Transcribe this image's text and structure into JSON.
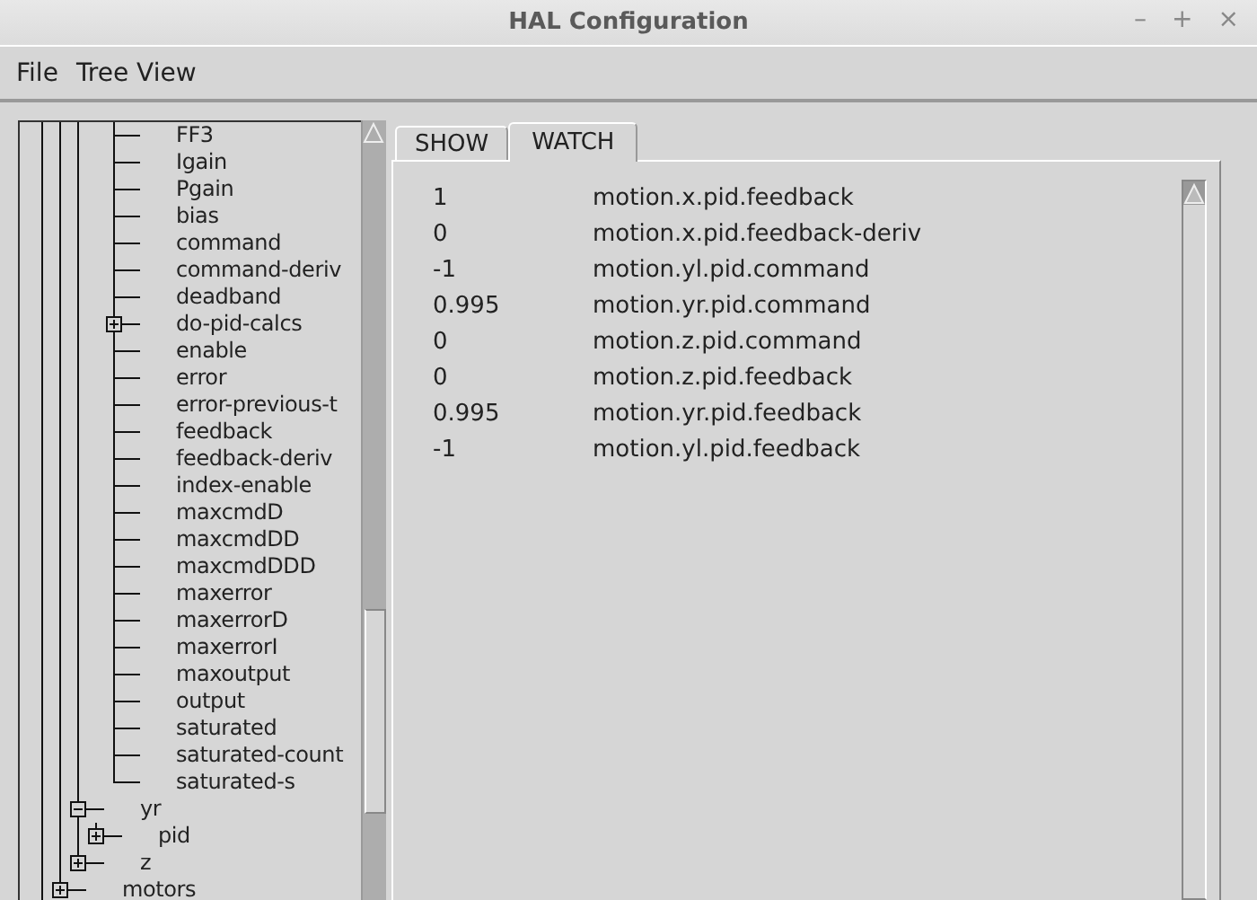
{
  "window": {
    "title": "HAL Configuration",
    "controls": [
      "–",
      "+",
      "×"
    ]
  },
  "menu": [
    "File",
    "Tree View"
  ],
  "tree": {
    "items": [
      {
        "children": [
          {
            "children": [
              {
                "children": [
                  {
                    "children": [
                      {
                        "label": "FF3"
                      },
                      {
                        "label": "Igain"
                      },
                      {
                        "label": "Pgain"
                      },
                      {
                        "label": "bias"
                      },
                      {
                        "label": "command"
                      },
                      {
                        "label": "command-deriv"
                      },
                      {
                        "label": "deadband"
                      },
                      {
                        "label": "do-pid-calcs",
                        "expanded": false
                      },
                      {
                        "label": "enable"
                      },
                      {
                        "label": "error"
                      },
                      {
                        "label": "error-previous-t"
                      },
                      {
                        "label": "feedback"
                      },
                      {
                        "label": "feedback-deriv"
                      },
                      {
                        "label": "index-enable"
                      },
                      {
                        "label": "maxcmdD"
                      },
                      {
                        "label": "maxcmdDD"
                      },
                      {
                        "label": "maxcmdDDD"
                      },
                      {
                        "label": "maxerror"
                      },
                      {
                        "label": "maxerrorD"
                      },
                      {
                        "label": "maxerrorI"
                      },
                      {
                        "label": "maxoutput"
                      },
                      {
                        "label": "output"
                      },
                      {
                        "label": "saturated"
                      },
                      {
                        "label": "saturated-count"
                      },
                      {
                        "label": "saturated-s"
                      }
                    ]
                  }
                ]
              },
              {
                "label": "yr",
                "expanded": true,
                "children": [
                  {
                    "label": "pid",
                    "expanded": false
                  }
                ]
              },
              {
                "label": "z",
                "expanded": false
              }
            ]
          },
          {
            "label": "motors",
            "expanded": false
          }
        ]
      }
    ]
  },
  "tabs": [
    {
      "label": "SHOW",
      "selected": false
    },
    {
      "label": "WATCH",
      "selected": true
    }
  ],
  "watch": [
    {
      "value": "1",
      "name": "motion.x.pid.feedback"
    },
    {
      "value": "0",
      "name": "motion.x.pid.feedback-deriv"
    },
    {
      "value": "-1",
      "name": "motion.yl.pid.command"
    },
    {
      "value": "0.995",
      "name": "motion.yr.pid.command"
    },
    {
      "value": "0",
      "name": "motion.z.pid.command"
    },
    {
      "value": "0",
      "name": "motion.z.pid.feedback"
    },
    {
      "value": "0.995",
      "name": "motion.yr.pid.feedback"
    },
    {
      "value": "-1",
      "name": "motion.yl.pid.feedback"
    }
  ]
}
